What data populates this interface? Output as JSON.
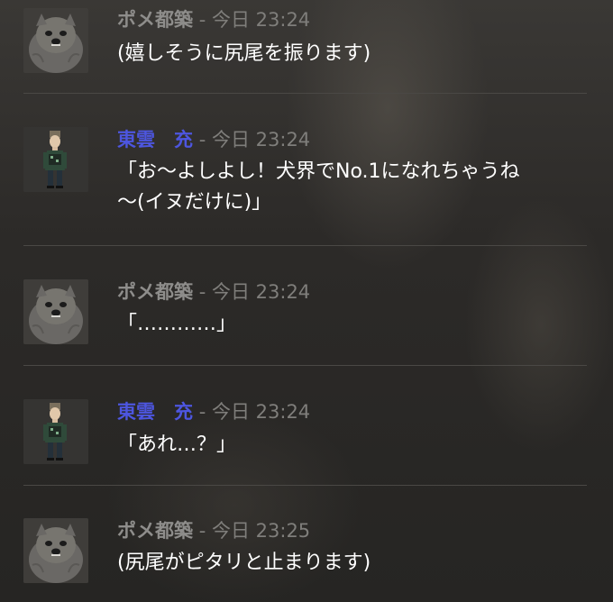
{
  "messages": [
    {
      "speaker": "ポメ都築",
      "separator": "-",
      "day": "今日",
      "time": "23:24",
      "lines": [
        "(嬉しそうに尻尾を振ります)"
      ],
      "avatar_icon": "pomeranian-avatar-icon"
    },
    {
      "speaker": "東雲　充",
      "separator": "-",
      "day": "今日",
      "time": "23:24",
      "lines": [
        "「お～よしよし！犬界でNo.1になれちゃうね",
        "～(イヌだけに)」"
      ],
      "avatar_icon": "soldier-avatar-icon"
    },
    {
      "speaker": "ポメ都築",
      "separator": "-",
      "day": "今日",
      "time": "23:24",
      "lines": [
        "「…………」"
      ],
      "avatar_icon": "pomeranian-avatar-icon"
    },
    {
      "speaker": "東雲　充",
      "separator": "-",
      "day": "今日",
      "time": "23:24",
      "lines": [
        "「あれ…？」"
      ],
      "avatar_icon": "soldier-avatar-icon"
    },
    {
      "speaker": "ポメ都築",
      "separator": "-",
      "day": "今日",
      "time": "23:25",
      "lines": [
        "(尻尾がピタリと止まります)"
      ],
      "avatar_icon": "pomeranian-avatar-icon"
    }
  ],
  "colors": {
    "pome_name": "#8e8d8b",
    "shino_name": "#4d56e0",
    "timestamp": "#7f7e7b",
    "message_text": "#ffffff",
    "divider": "#4a4845"
  }
}
